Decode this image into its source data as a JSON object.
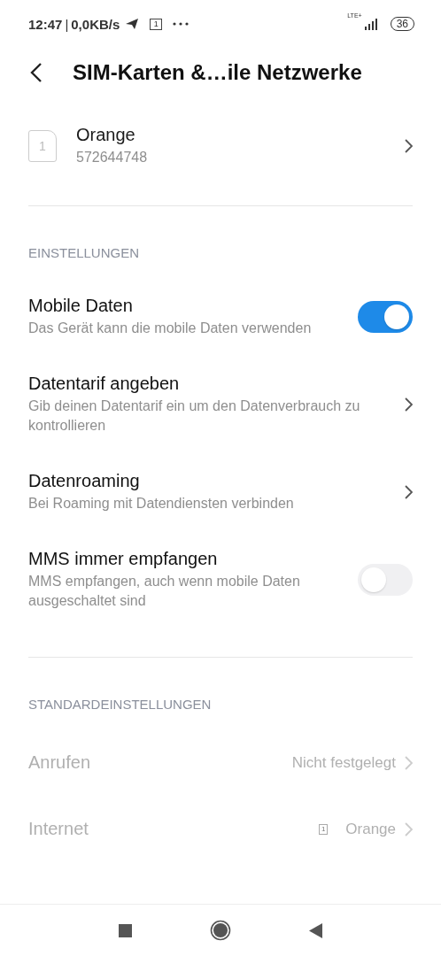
{
  "status_bar": {
    "time": "12:47",
    "separator": "|",
    "speed": "0,0KB/s",
    "calendar_day": "1",
    "network": "LTE+",
    "battery": "36"
  },
  "header": {
    "title": "SIM-Karten &…ile Netzwerke"
  },
  "sim": {
    "slot": "1",
    "name": "Orange",
    "number": "572644748"
  },
  "sections": [
    {
      "title": "EINSTELLUNGEN",
      "items": [
        {
          "kind": "toggle",
          "title": "Mobile Daten",
          "subtitle": "Das Gerät kann die mobile Daten verwenden",
          "on": true,
          "disabled": false
        },
        {
          "kind": "link",
          "title": "Datentarif angeben",
          "subtitle": "Gib deinen Datentarif ein um den Datenverbrauch zu kontrollieren",
          "disabled": false
        },
        {
          "kind": "link",
          "title": "Datenroaming",
          "subtitle": "Bei Roaming mit Datendiensten verbinden",
          "disabled": false
        },
        {
          "kind": "toggle",
          "title": "MMS immer empfangen",
          "subtitle": "MMS empfangen, auch wenn mobile Daten ausgeschaltet sind",
          "on": false,
          "disabled": false
        }
      ]
    },
    {
      "title": "STANDARDEINSTELLUNGEN",
      "items": [
        {
          "kind": "value",
          "title": "Anrufen",
          "value": "Nicht festgelegt",
          "disabled": true
        },
        {
          "kind": "sim_value",
          "title": "Internet",
          "slot": "1",
          "value": "Orange",
          "disabled": true
        }
      ]
    }
  ]
}
